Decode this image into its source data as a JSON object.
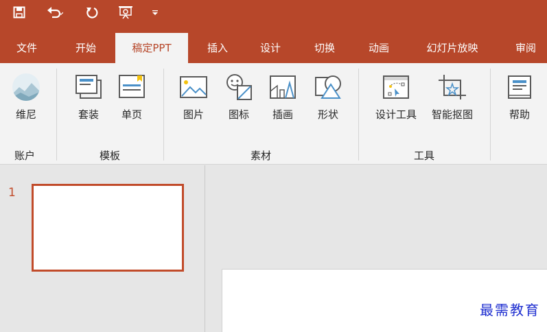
{
  "colors": {
    "accent": "#b7472a",
    "ribbon_bg": "#f3f3f3",
    "slide_border": "#c14b2a",
    "watermark": "#1f2fd0"
  },
  "qat": {
    "icons": [
      "save-icon",
      "undo-icon",
      "redo-icon",
      "present-icon",
      "customize-dropdown-icon"
    ]
  },
  "tabs": [
    {
      "label": "文件"
    },
    {
      "label": "开始"
    },
    {
      "label": "稿定PPT",
      "active": true
    },
    {
      "label": "插入"
    },
    {
      "label": "设计"
    },
    {
      "label": "切换"
    },
    {
      "label": "动画"
    },
    {
      "label": "幻灯片放映"
    },
    {
      "label": "审阅"
    }
  ],
  "ribbon": {
    "buttons": {
      "account": "维尼",
      "suite": "套装",
      "single_page": "单页",
      "picture": "图片",
      "icon": "图标",
      "illustration": "插画",
      "shape": "形状",
      "design_tool": "设计工具",
      "smart_cutout": "智能抠图",
      "help": "帮助"
    },
    "groups": {
      "account": "账户",
      "template": "模板",
      "material": "素材",
      "tools": "工具"
    }
  },
  "slides": [
    {
      "number": "1"
    }
  ],
  "watermark": "最需教育"
}
